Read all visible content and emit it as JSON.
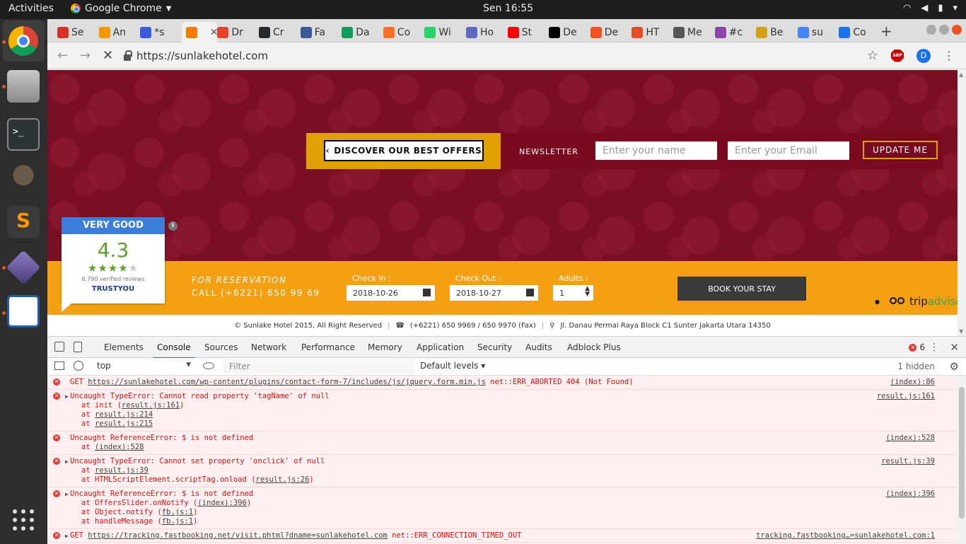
{
  "topbar": {
    "activities": "Activities",
    "app_name": "Google Chrome",
    "clock": "Sen 16:55"
  },
  "tabs": [
    {
      "label": "Se",
      "color": "#d93025"
    },
    {
      "label": "An",
      "color": "#f29900"
    },
    {
      "label": "*s",
      "color": "#3b5bdb"
    },
    {
      "label": "",
      "color": "#f57c00",
      "active": true
    },
    {
      "label": "Dr",
      "color": "#e24329"
    },
    {
      "label": "Cr",
      "color": "#24292e"
    },
    {
      "label": "Fa",
      "color": "#3b5998"
    },
    {
      "label": "Da",
      "color": "#0f9d58"
    },
    {
      "label": "Co",
      "color": "#fc6d26"
    },
    {
      "label": "Wi",
      "color": "#25d366"
    },
    {
      "label": "Ho",
      "color": "#5c6bc0"
    },
    {
      "label": "St",
      "color": "#ff0000"
    },
    {
      "label": "De",
      "color": "#000000"
    },
    {
      "label": "De",
      "color": "#f4511e"
    },
    {
      "label": "HT",
      "color": "#e44d26"
    },
    {
      "label": "Me",
      "color": "#555555"
    },
    {
      "label": "#c",
      "color": "#8e44ad"
    },
    {
      "label": "Be",
      "color": "#d4a017"
    },
    {
      "label": "su",
      "color": "#4285f4"
    },
    {
      "label": "Co",
      "color": "#1a73e8"
    }
  ],
  "omnibox": {
    "url": "https://sunlakehotel.com",
    "avatar_letter": "D",
    "abp": "ABP"
  },
  "site": {
    "offer_button": "DISCOVER OUR BEST OFFERS",
    "newsletter_label": "NEWSLETTER",
    "name_placeholder": "Enter your name",
    "email_placeholder": "Enter your Email",
    "update_button": "UPDATE ME",
    "reservation_title": "FOR RESERVATION",
    "reservation_phone": "CALL (+6221) 650 99 69",
    "checkin_label": "Check In :",
    "checkin_value": "2018-10-26",
    "checkout_label": "Check Out :",
    "checkout_value": "2018-10-27",
    "adults_label": "Adults :",
    "adults_value": "1",
    "book_button": "BOOK YOUR STAY",
    "tripadvisor_trip": "trip",
    "tripadvisor_advisor": "advisor",
    "trust": {
      "rating_text": "VERY GOOD",
      "score": "4.3",
      "stars_full": "★★★★",
      "stars_empty": "★",
      "reviews": "6,790 verified reviews",
      "logo": "TRUSTYOU"
    },
    "footer": {
      "copyright": "© Sunlake Hotel 2015, All Right Reserved",
      "phone": "(+6221) 650 9969 / 650 9970 (Fax)",
      "address": "Jl. Danau Permai Raya Block C1 Sunter Jakarta Utara 14350"
    }
  },
  "devtools": {
    "tabs": [
      "Elements",
      "Console",
      "Sources",
      "Network",
      "Performance",
      "Memory",
      "Application",
      "Security",
      "Audits",
      "Adblock Plus"
    ],
    "active_tab": "Console",
    "error_count": "6",
    "context": "top",
    "filter_placeholder": "Filter",
    "levels": "Default levels",
    "hidden": "1 hidden",
    "messages": [
      {
        "prefix": "GET ",
        "link": "https://sunlakehotel.com/wp-content/plugins/contact-form-7/includes/js/jquery.form.min.js",
        "suffix": " net::ERR_ABORTED 404 (Not Found)",
        "source": "(index):86",
        "stack": []
      },
      {
        "prefix": "Uncaught TypeError: Cannot read property 'tagName' of null",
        "source": "result.js:161",
        "expandable": true,
        "stack": [
          {
            "pre": "at init (",
            "link": "result.js:161",
            "post": ")"
          },
          {
            "pre": "at ",
            "link": "result.js:214",
            "post": ""
          },
          {
            "pre": "at ",
            "link": "result.js:215",
            "post": ""
          }
        ]
      },
      {
        "prefix": "Uncaught ReferenceError: $ is not defined",
        "source": "(index):528",
        "expandable": false,
        "stack": [
          {
            "pre": "at ",
            "link": "(index):528",
            "post": ""
          }
        ]
      },
      {
        "prefix": "Uncaught TypeError: Cannot set property 'onclick' of null",
        "source": "result.js:39",
        "expandable": true,
        "stack": [
          {
            "pre": "at ",
            "link": "result.js:39",
            "post": ""
          },
          {
            "pre": "at HTMLScriptElement.scriptTag.onload (",
            "link": "result.js:26",
            "post": ")"
          }
        ]
      },
      {
        "prefix": "Uncaught ReferenceError: $ is not defined",
        "source": "(index):396",
        "expandable": true,
        "stack": [
          {
            "pre": "at OffersSlider.onNotify (",
            "link": "(index):396",
            "post": ")"
          },
          {
            "pre": "at Object.notify (",
            "link": "fb.js:1",
            "post": ")"
          },
          {
            "pre": "at handleMessage (",
            "link": "fb.js:1",
            "post": ")"
          }
        ]
      },
      {
        "prefix": "GET ",
        "link": "https://tracking.fastbooking.net/visit.phtml?dname=sunlakehotel.com",
        "suffix": " net::ERR_CONNECTION_TIMED_OUT",
        "source": "tracking.fastbooking…=sunlakehotel.com:1",
        "expandable": true,
        "stack": []
      }
    ]
  },
  "colors": {
    "site_maroon": "#7a0f24",
    "site_orange": "#f5a012",
    "offer_gold": "#e0a000",
    "trust_blue": "#3b7dd8",
    "trust_green": "#5a9f2a",
    "error_red": "#e53935"
  }
}
